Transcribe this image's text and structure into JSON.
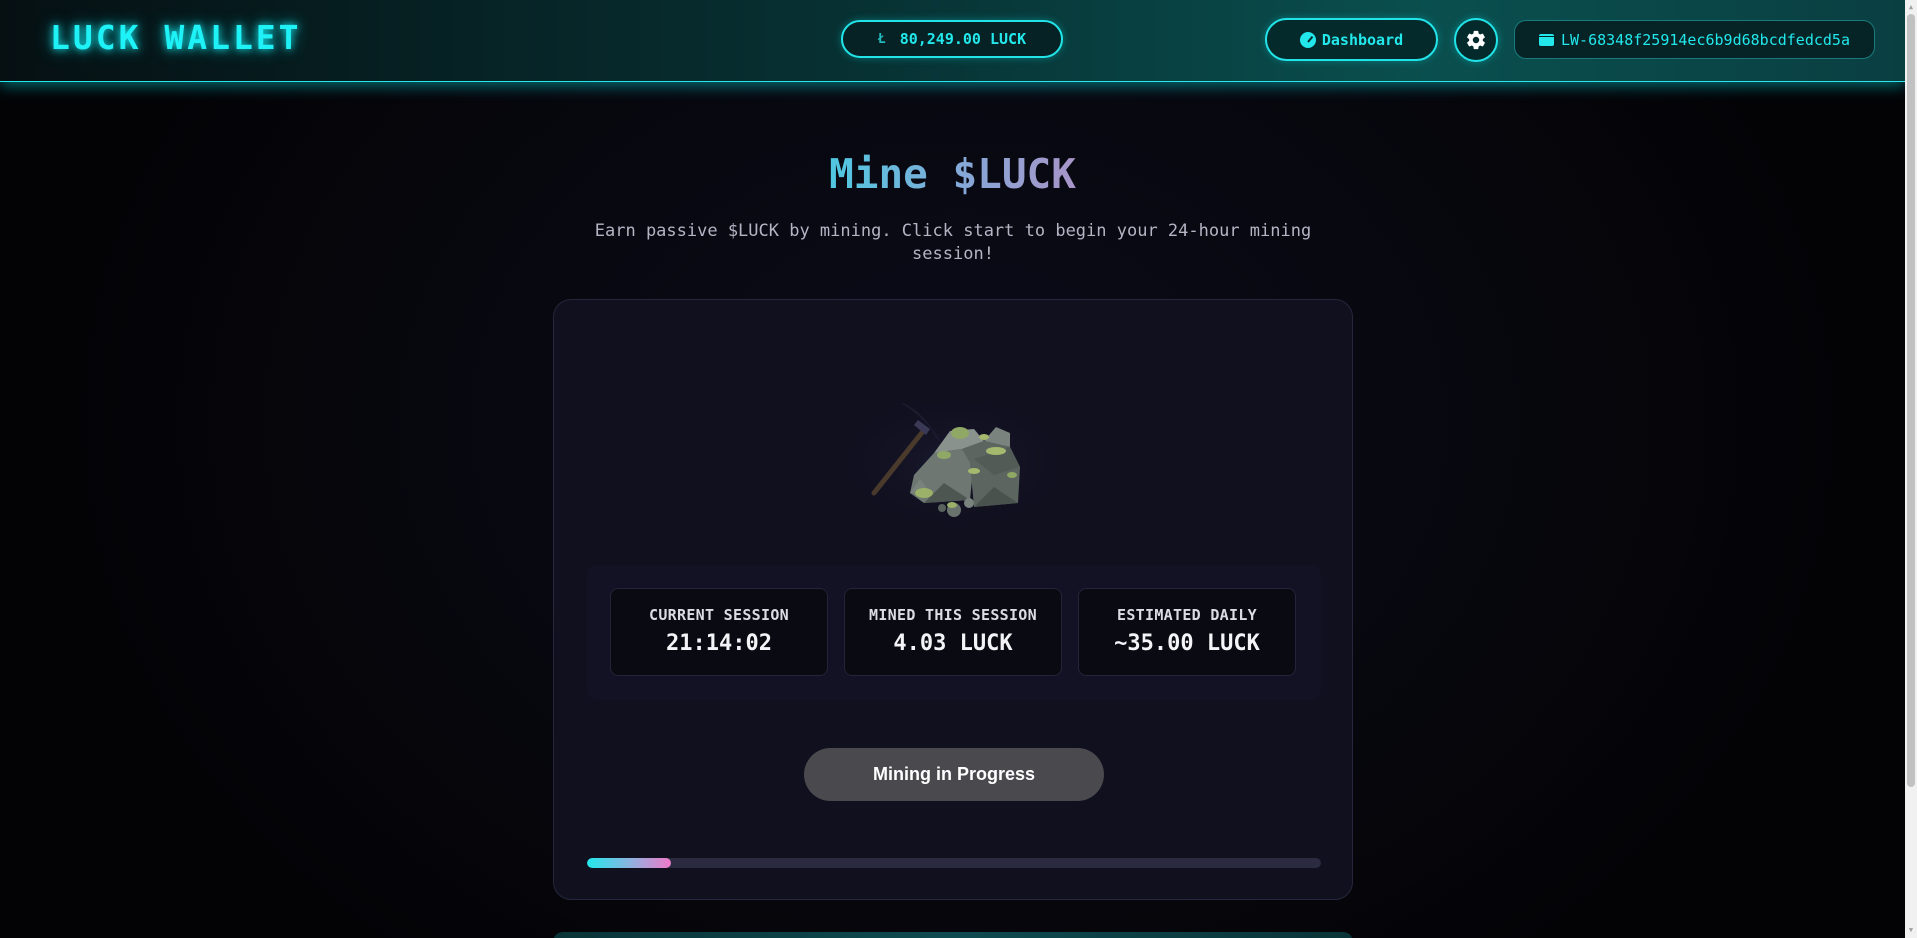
{
  "header": {
    "logo": "LUCK WALLET",
    "balance": "80,249.00 LUCK",
    "dashboard_label": "Dashboard",
    "wallet_id": "LW-68348f25914ec6b9d68bcdfedcd5a",
    "accent_color": "#22e8ec"
  },
  "icons": {
    "balance": "luck-coin-icon",
    "dashboard": "gauge-icon",
    "settings": "gear-icon",
    "wallet": "wallet-icon"
  },
  "main": {
    "title": "Mine $LUCK",
    "subtitle": "Earn passive $LUCK by mining. Click start to begin your 24-hour mining session!"
  },
  "stats": [
    {
      "label": "CURRENT SESSION",
      "value": "21:14:02"
    },
    {
      "label": "MINED THIS SESSION",
      "value": "4.03 LUCK"
    },
    {
      "label": "ESTIMATED DAILY",
      "value": "~35.00 LUCK"
    }
  ],
  "mining": {
    "button_label": "Mining in Progress",
    "progress_fraction": 0.115
  }
}
